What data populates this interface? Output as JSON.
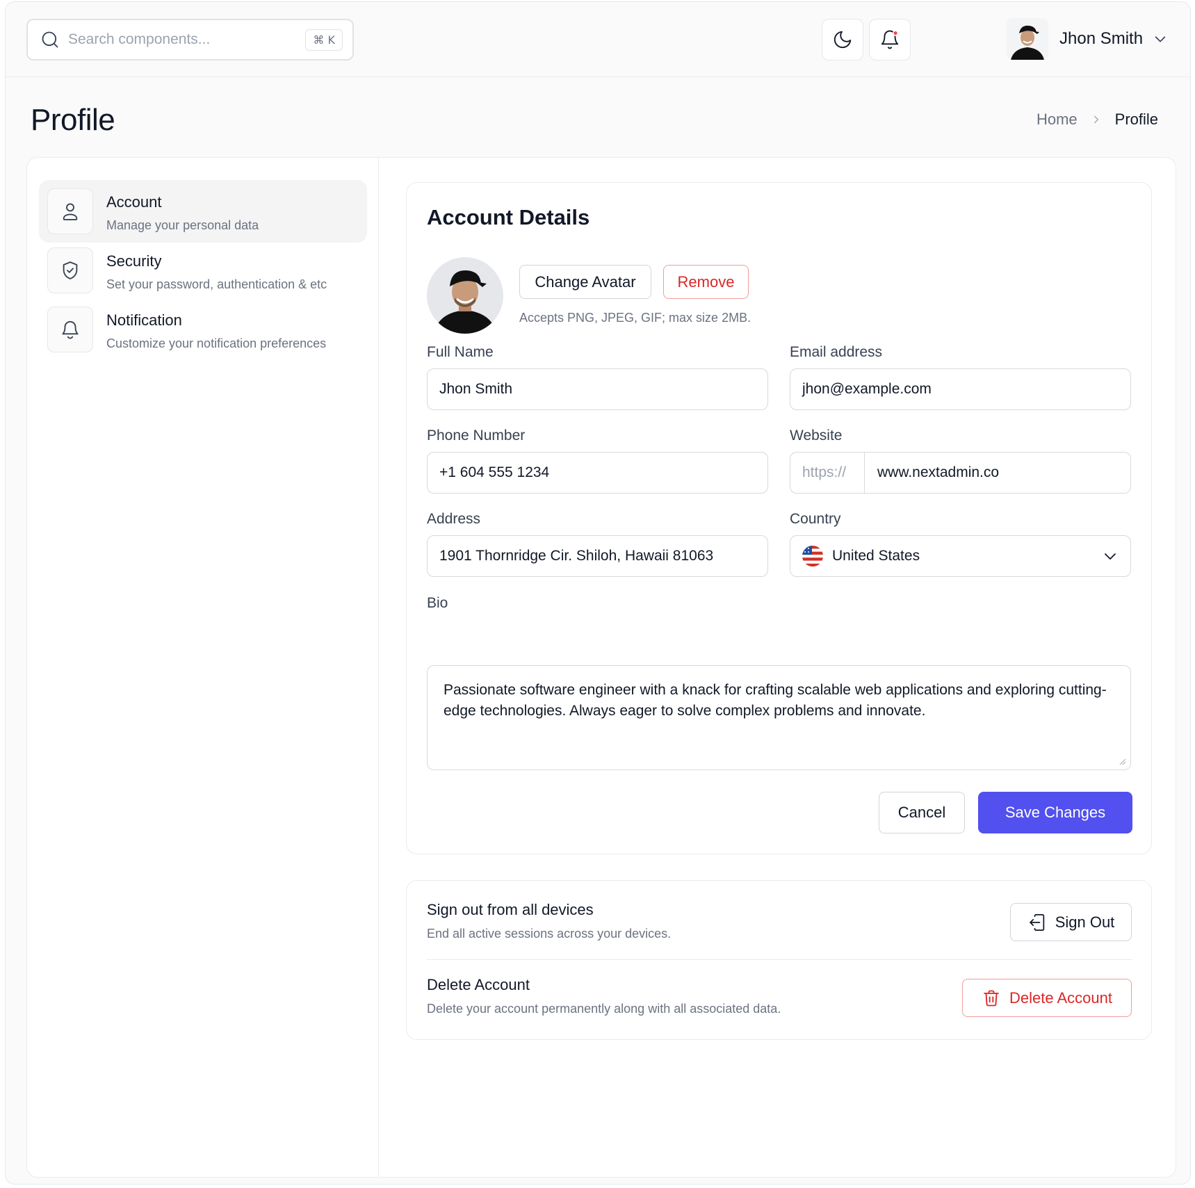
{
  "topbar": {
    "search_placeholder": "Search components...",
    "search_shortcut": "⌘ K",
    "user_name": "Jhon Smith"
  },
  "page": {
    "title": "Profile",
    "breadcrumb": [
      "Home",
      "Profile"
    ]
  },
  "sidebar": {
    "items": [
      {
        "title": "Account",
        "subtitle": "Manage your personal data",
        "icon": "user-icon",
        "active": true
      },
      {
        "title": "Security",
        "subtitle": "Set your password, authentication & etc",
        "icon": "shield-check-icon",
        "active": false
      },
      {
        "title": "Notification",
        "subtitle": "Customize your notification preferences",
        "icon": "bell-icon",
        "active": false
      }
    ]
  },
  "account_details": {
    "title": "Account Details",
    "change_avatar_label": "Change Avatar",
    "remove_label": "Remove",
    "avatar_hint": "Accepts PNG, JPEG, GIF; max size 2MB.",
    "fields": {
      "full_name": {
        "label": "Full Name",
        "value": "Jhon Smith"
      },
      "email": {
        "label": "Email address",
        "value": "jhon@example.com"
      },
      "phone": {
        "label": "Phone Number",
        "value": "+1 604 555 1234"
      },
      "website": {
        "label": "Website",
        "prefix": "https://",
        "value": "www.nextadmin.co"
      },
      "address": {
        "label": "Address",
        "value": "1901 Thornridge Cir. Shiloh, Hawaii 81063"
      },
      "country": {
        "label": "Country",
        "value": "United States",
        "flag": "us-flag-icon"
      },
      "bio": {
        "label": "Bio",
        "value": "Passionate software engineer with a knack for crafting scalable web applications and exploring cutting-edge technologies. Always eager to solve complex problems and innovate."
      }
    },
    "cancel_label": "Cancel",
    "save_label": "Save Changes"
  },
  "danger_zone": {
    "sign_out": {
      "title": "Sign out from all devices",
      "subtitle": "End all active sessions across your devices.",
      "button": "Sign Out"
    },
    "delete": {
      "title": "Delete Account",
      "subtitle": "Delete your account permanently along with all associated data.",
      "button": "Delete Account"
    }
  },
  "colors": {
    "primary": "#5250ee",
    "danger": "#dc2626",
    "notification_dot": "#ef4444"
  }
}
